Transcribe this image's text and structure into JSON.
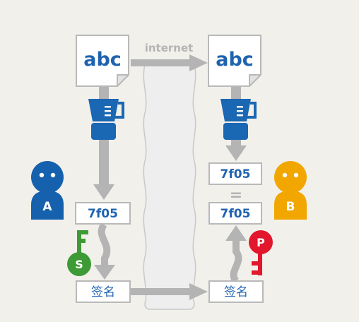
{
  "network_label": "internet",
  "sender": {
    "document_text": "abc",
    "hash_text": "7f05",
    "person_label": "A",
    "key_label": "S",
    "signature_text": "签名"
  },
  "receiver": {
    "document_text": "abc",
    "computed_hash_text": "7f05",
    "equals_symbol": "=",
    "decrypted_hash_text": "7f05",
    "person_label": "B",
    "key_label": "P",
    "signature_text": "签名"
  },
  "colors": {
    "background": "#f2f0eb",
    "box_border": "#b9b9b9",
    "arrow": "#b4b4b4",
    "text_blue": "#1f63b0",
    "person_a": "#1661ad",
    "person_b": "#f1a600",
    "key_s": "#3d9a35",
    "key_p": "#e2162c",
    "blender": "#1a67b3"
  },
  "icons": [
    "document-icon",
    "blender-icon",
    "person-icon",
    "key-icon"
  ]
}
